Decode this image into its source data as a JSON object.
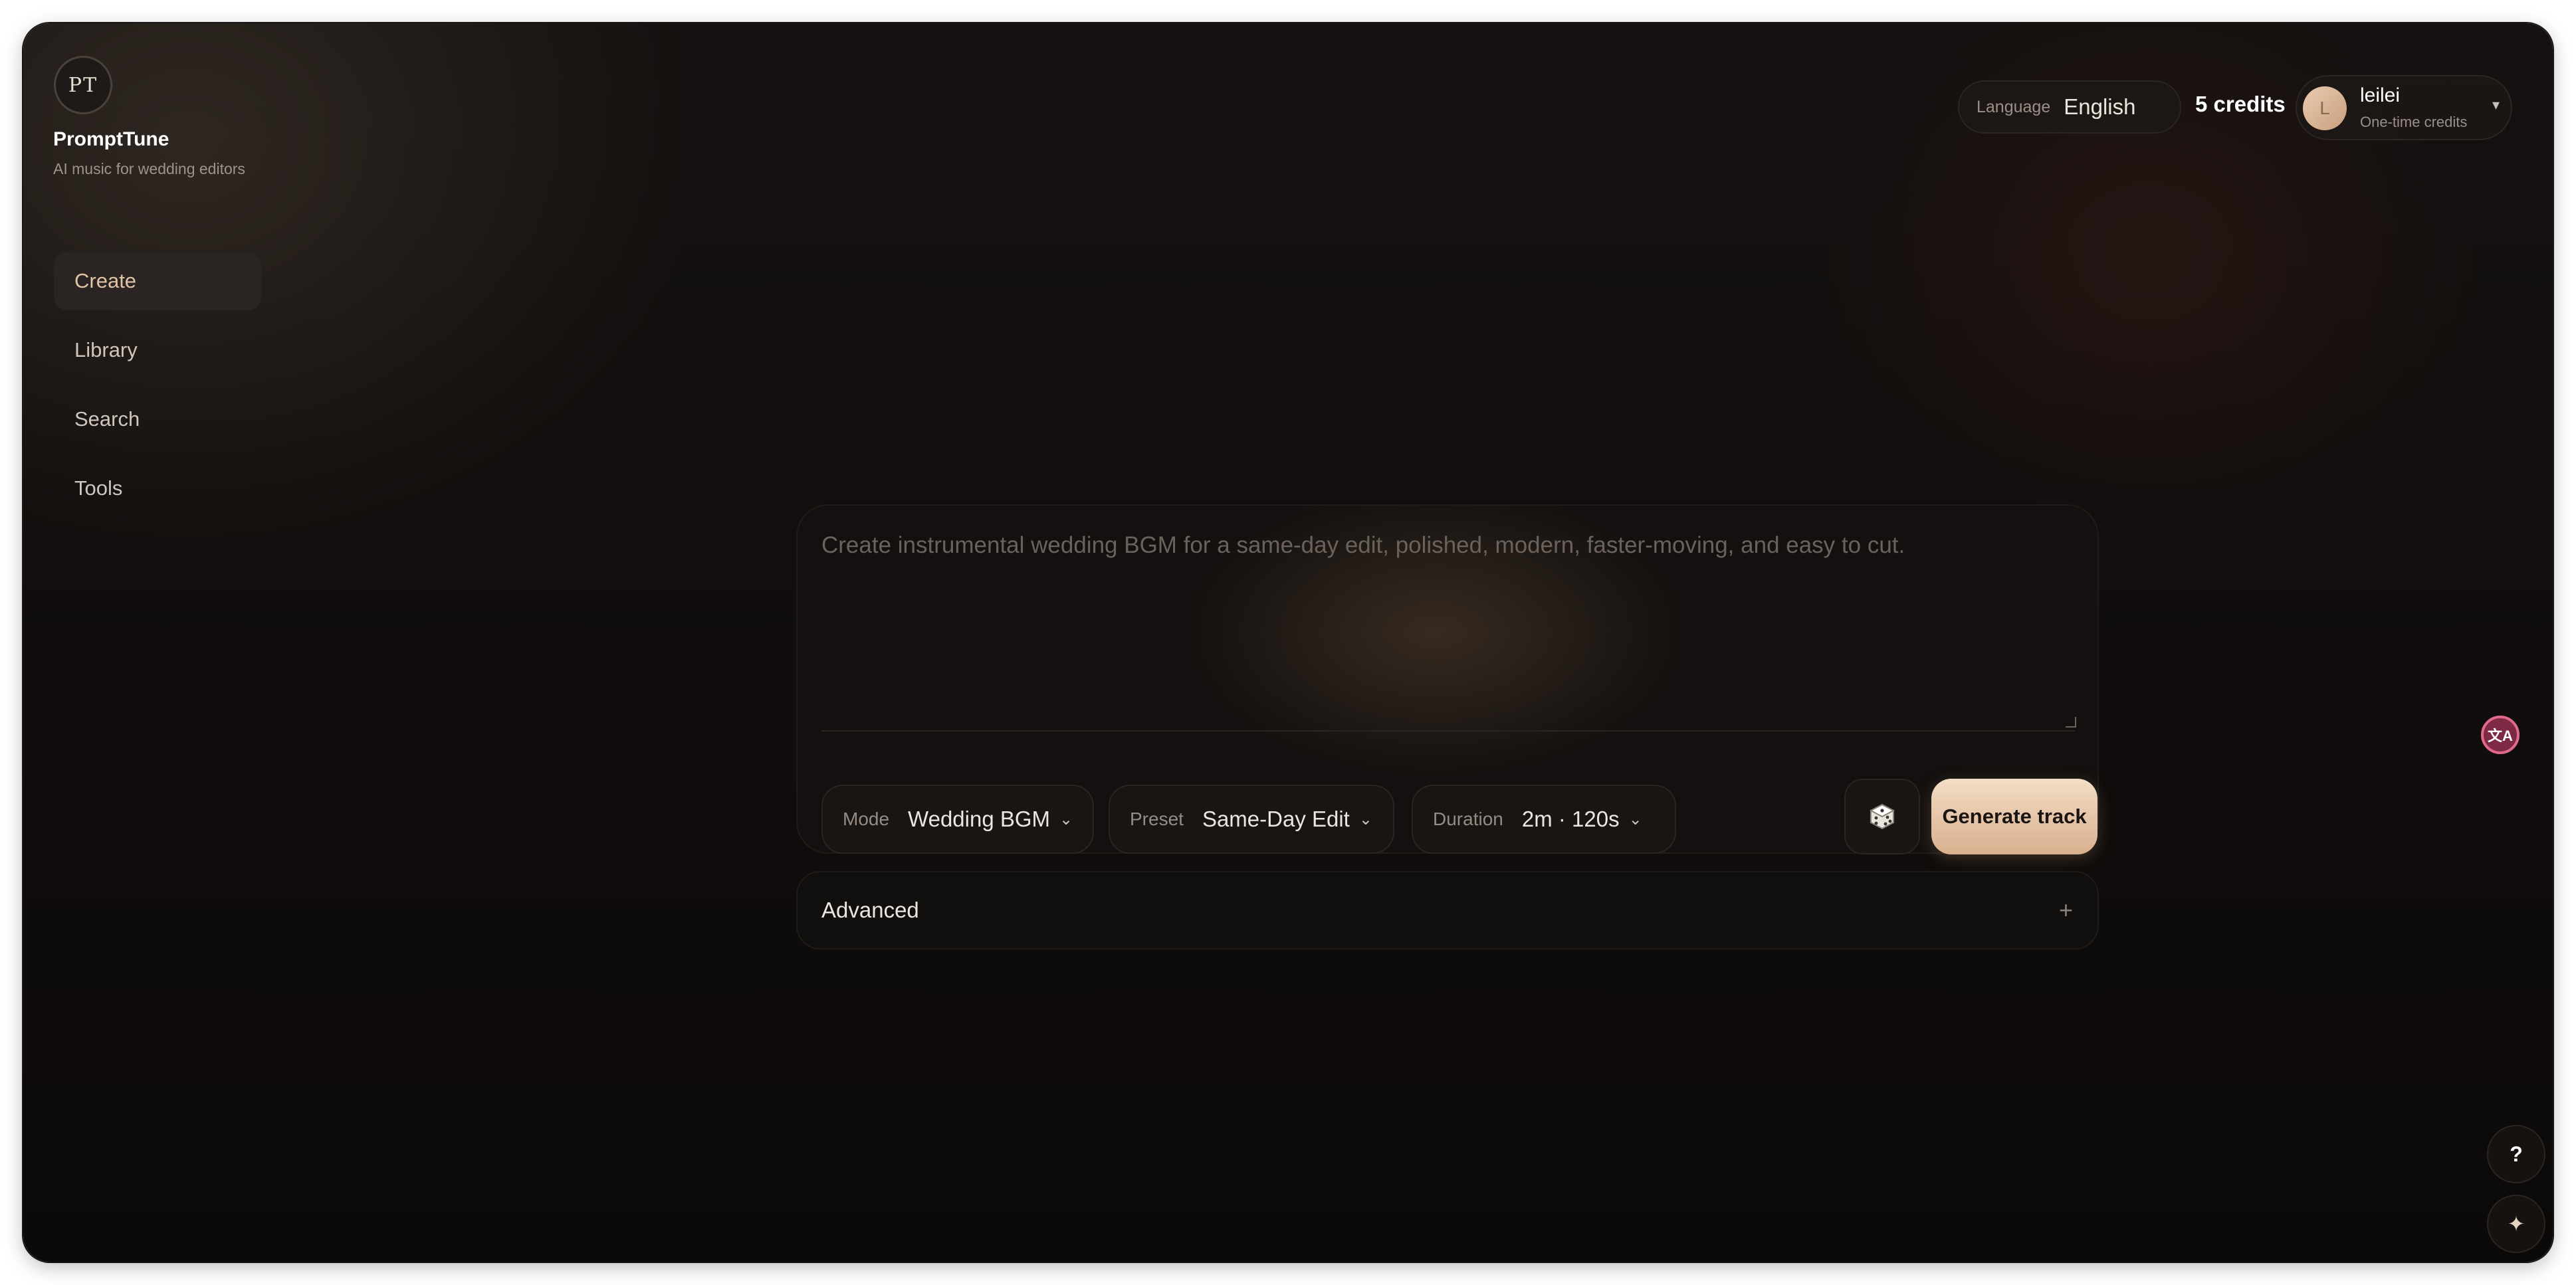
{
  "brand": {
    "logo_text": "PT",
    "name": "PromptTune",
    "tagline": "AI music for wedding editors"
  },
  "sidebar": {
    "items": [
      {
        "label": "Create",
        "active": true
      },
      {
        "label": "Library",
        "active": false
      },
      {
        "label": "Search",
        "active": false
      },
      {
        "label": "Tools",
        "active": false
      }
    ]
  },
  "header": {
    "language_label": "Language",
    "language_value": "English",
    "credits": "5 credits",
    "user": {
      "initial": "L",
      "name": "leilei",
      "plan": "One-time credits",
      "caret": "▾"
    }
  },
  "composer": {
    "placeholder": "Create instrumental wedding BGM for a same-day edit, polished, modern, faster-moving, and easy to cut.",
    "mode": {
      "label": "Mode",
      "value": "Wedding BGM"
    },
    "preset": {
      "label": "Preset",
      "value": "Same-Day Edit"
    },
    "duration": {
      "label": "Duration",
      "value": "2m · 120s"
    },
    "chevron": "⌄",
    "dice_icon": "dice-icon",
    "generate_label": "Generate track"
  },
  "advanced": {
    "label": "Advanced",
    "toggle": "+"
  },
  "floating": {
    "translate_glyph": "文A",
    "help": "?",
    "spark": "✦"
  },
  "colors": {
    "accent": "#d9b08e",
    "active_nav_text": "#e0c4a4",
    "background": "#100d0c"
  }
}
